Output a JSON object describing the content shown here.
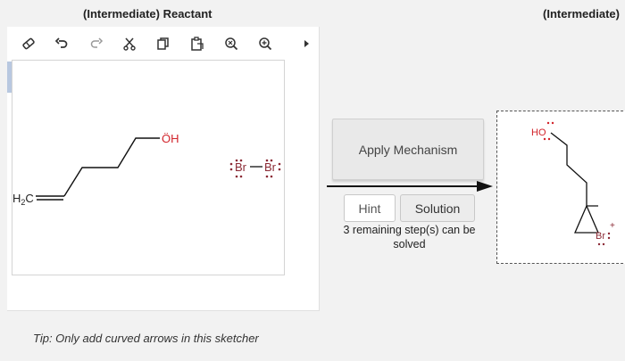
{
  "titles": {
    "reactant": "(Intermediate) Reactant",
    "product": "(Intermediate)"
  },
  "toolbar": {
    "tools": [
      "eraser-icon",
      "undo-icon",
      "redo-icon",
      "cut-icon",
      "copy-icon",
      "paste-icon",
      "zoom-out-icon",
      "zoom-in-icon",
      "more-arrow-icon"
    ]
  },
  "reactant_molecule": {
    "end_group": "H2C",
    "h2c_main": "H",
    "h2c_sub": "2",
    "h2c_tail": "C",
    "alcohol": "ÖH",
    "bromine_left": "Br",
    "bromine_right": "Br"
  },
  "actions": {
    "apply": "Apply Mechanism",
    "hint": "Hint",
    "solution": "Solution",
    "remaining": "3 remaining step(s) can be solved"
  },
  "product_molecule": {
    "hydroxyl": "HO",
    "bromonium": "Br",
    "charge": "+"
  },
  "tip": "Tip: Only add curved arrows in this sketcher",
  "colors": {
    "oxygen": "#d2232a",
    "bromine": "#8b2a35",
    "bond": "#000000"
  }
}
